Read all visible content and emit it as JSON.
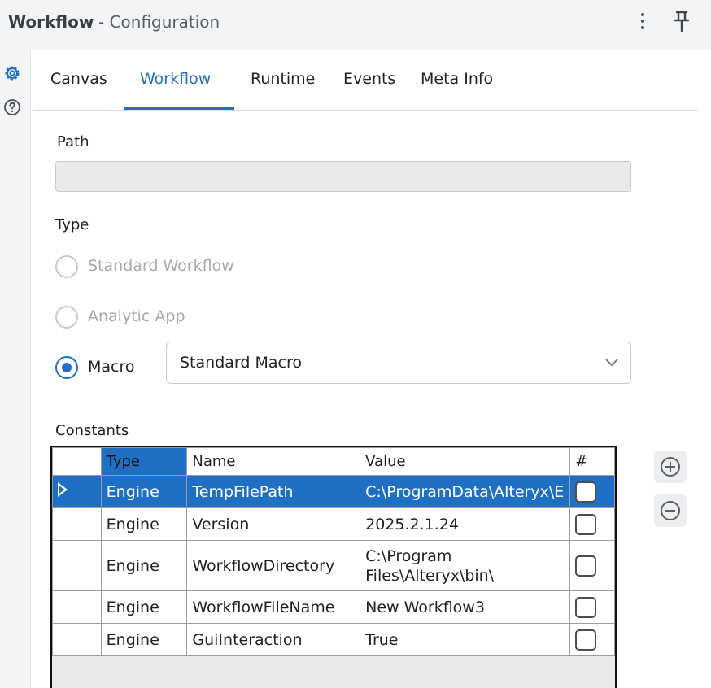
{
  "window": {
    "title": "Workflow",
    "subtitle": "- Configuration",
    "menu_icon": "kebab-icon",
    "pin_icon": "pin-icon"
  },
  "side_rail": [
    {
      "icon": "gear-icon",
      "active": true
    },
    {
      "icon": "help-icon",
      "active": false
    }
  ],
  "tabs": [
    {
      "label": "Canvas",
      "active": false
    },
    {
      "label": "Workflow",
      "active": true
    },
    {
      "label": "Runtime",
      "active": false
    },
    {
      "label": "Events",
      "active": false
    },
    {
      "label": "Meta Info",
      "active": false
    }
  ],
  "path": {
    "label": "Path",
    "value": ""
  },
  "type": {
    "label": "Type",
    "options": [
      {
        "label": "Standard Workflow",
        "checked": false,
        "enabled": false
      },
      {
        "label": "Analytic App",
        "checked": false,
        "enabled": false
      },
      {
        "label": "Macro",
        "checked": true,
        "enabled": true
      }
    ],
    "macro_select_value": "Standard Macro"
  },
  "constants": {
    "label": "Constants",
    "columns": [
      "Type",
      "Name",
      "Value",
      "#"
    ],
    "rows": [
      {
        "type": "Engine",
        "name": "TempFilePath",
        "value": "C:\\ProgramData\\Alteryx\\E",
        "checked": false,
        "selected": true
      },
      {
        "type": "Engine",
        "name": "Version",
        "value": "2025.2.1.24",
        "checked": false,
        "selected": false
      },
      {
        "type": "Engine",
        "name": "WorkflowDirectory",
        "value": "C:\\Program Files\\Alteryx\\bin\\",
        "checked": false,
        "selected": false
      },
      {
        "type": "Engine",
        "name": "WorkflowFileName",
        "value": "New Workflow3",
        "checked": false,
        "selected": false
      },
      {
        "type": "Engine",
        "name": "GuiInteraction",
        "value": "True",
        "checked": false,
        "selected": false
      }
    ],
    "add_icon": "plus-circle-icon",
    "remove_icon": "minus-circle-icon"
  },
  "colors": {
    "accent": "#1f6fc4",
    "selection": "#1f6fc4",
    "panel": "#f3f4f6"
  }
}
